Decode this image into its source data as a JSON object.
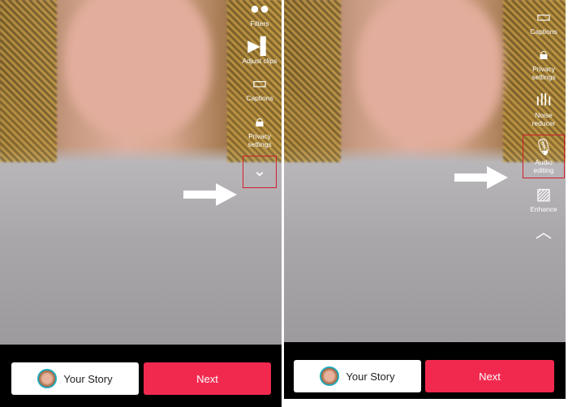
{
  "left": {
    "tools": [
      {
        "icon": "filters-icon",
        "label": "Filters"
      },
      {
        "icon": "adjust-clips-icon",
        "label": "Adjust clips"
      },
      {
        "icon": "captions-icon",
        "label": "Captions"
      },
      {
        "icon": "lock-icon",
        "label": "Privacy settings"
      }
    ],
    "expand_icon": "chevron-down-icon",
    "story_label": "Your Story",
    "next_label": "Next"
  },
  "right": {
    "tools": [
      {
        "icon": "captions-icon",
        "label": "Captions"
      },
      {
        "icon": "lock-icon",
        "label": "Privacy settings"
      },
      {
        "icon": "waveform-icon",
        "label": "Noise reducer"
      },
      {
        "icon": "microphone-icon",
        "label": "Audio editing"
      },
      {
        "icon": "enhance-icon",
        "label": "Enhance"
      }
    ],
    "collapse_icon": "chevron-up-icon",
    "story_label": "Your Story",
    "next_label": "Next"
  },
  "colors": {
    "next": "#f2294f",
    "highlight": "#d0202a"
  }
}
